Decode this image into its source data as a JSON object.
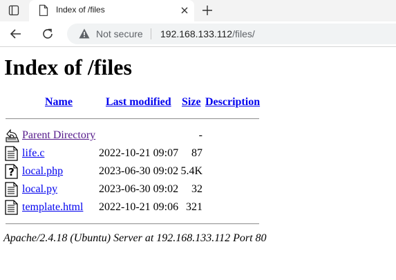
{
  "browser": {
    "tab_title": "Index of /files",
    "security_label": "Not secure",
    "url_host": "192.168.133.112",
    "url_path": "/files/"
  },
  "page": {
    "title": "Index of /files",
    "columns": {
      "name": "Name",
      "last_modified": "Last modified",
      "size": "Size",
      "description": "Description"
    },
    "parent": {
      "name": "Parent Directory",
      "size": "-"
    },
    "files": [
      {
        "name": "life.c",
        "modified": "2022-10-21 09:07",
        "size": "87",
        "icon": "text-file-icon"
      },
      {
        "name": "local.php",
        "modified": "2023-06-30 09:02",
        "size": "5.4K",
        "icon": "unknown-file-icon"
      },
      {
        "name": "local.py",
        "modified": "2023-06-30 09:02",
        "size": "32",
        "icon": "text-file-icon"
      },
      {
        "name": "template.html",
        "modified": "2022-10-21 09:06",
        "size": "321",
        "icon": "text-file-icon"
      }
    ],
    "footer": "Apache/2.4.18 (Ubuntu) Server at 192.168.133.112 Port 80"
  }
}
